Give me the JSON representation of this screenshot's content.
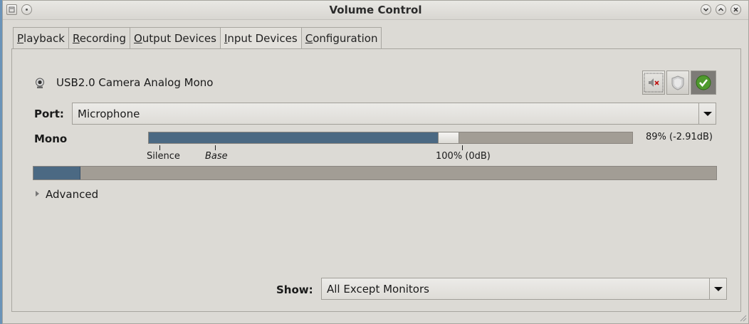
{
  "window": {
    "title": "Volume Control"
  },
  "tabs": [
    {
      "prefix": "",
      "mnemonic": "P",
      "rest": "layback"
    },
    {
      "prefix": "",
      "mnemonic": "R",
      "rest": "ecording"
    },
    {
      "prefix": "",
      "mnemonic": "O",
      "rest": "utput Devices"
    },
    {
      "prefix": "",
      "mnemonic": "I",
      "rest": "nput Devices"
    },
    {
      "prefix": "",
      "mnemonic": "C",
      "rest": "onfiguration"
    }
  ],
  "active_tab": "Input Devices",
  "device": {
    "name": "USB2.0 Camera Analog Mono",
    "icon": "webcam-icon"
  },
  "buttons": {
    "mute_icon": "speaker-muted-icon",
    "lock_icon": "shield-icon",
    "default_icon": "checkmark-icon"
  },
  "port": {
    "label": "Port:",
    "value": "Microphone"
  },
  "channel": {
    "label": "Mono",
    "volume_fraction": 0.6,
    "readout": "89% (-2.91dB)",
    "marks": [
      {
        "label": "Silence",
        "italic": false
      },
      {
        "label": "Base",
        "italic": true
      },
      {
        "label": "100% (0dB)",
        "italic": false
      }
    ]
  },
  "level_meter": {
    "fraction": 0.068
  },
  "advanced": {
    "label": "Advanced"
  },
  "show": {
    "label_mnemonic": "Show:",
    "value": "All Except Monitors"
  },
  "colors": {
    "accent": "#4b6983",
    "trough": "#a29d95",
    "background": "#dcdad5"
  }
}
